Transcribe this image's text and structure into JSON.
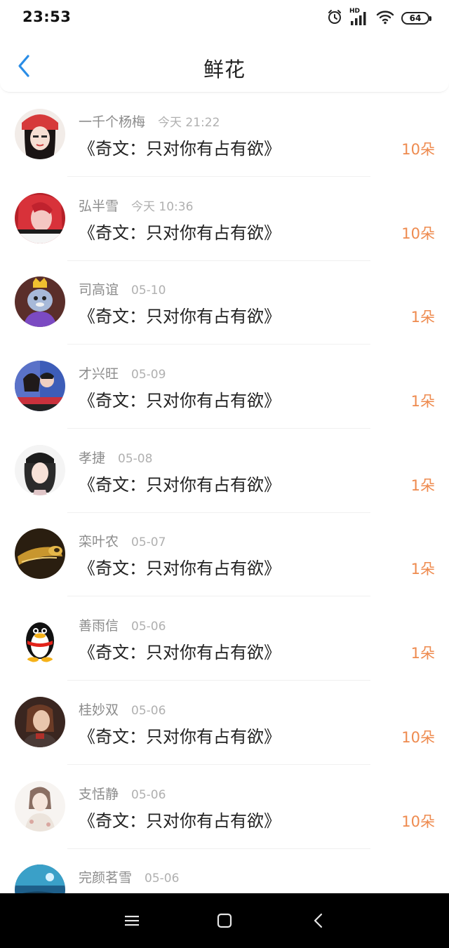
{
  "status_bar": {
    "time": "23:53",
    "network_label": "HD",
    "battery_level": "64",
    "icons": [
      "alarm-icon",
      "signal-icon",
      "wifi-icon",
      "battery-icon"
    ]
  },
  "header": {
    "title": "鲜花",
    "back_icon": "chevron-left-icon",
    "accent_color": "#2a8de6"
  },
  "list": {
    "count_color": "#ee8a4e",
    "items": [
      {
        "user": "一千个杨梅",
        "time": "今天 21:22",
        "title": "《奇文：只对你有占有欲》",
        "count": "10朵",
        "avatar": "portrait-girl-red-hat"
      },
      {
        "user": "弘半雪",
        "time": "今天 10:36",
        "title": "《奇文：只对你有占有欲》",
        "count": "10朵",
        "avatar": "portrait-red-hair"
      },
      {
        "user": "司高谊",
        "time": "05-10",
        "title": "《奇文：只对你有占有欲》",
        "count": "1朵",
        "avatar": "cartoon-rabbit-crown"
      },
      {
        "user": "才兴旺",
        "time": "05-09",
        "title": "《奇文：只对你有占有欲》",
        "count": "1朵",
        "avatar": "couple-photo"
      },
      {
        "user": "孝捷",
        "time": "05-08",
        "title": "《奇文：只对你有占有欲》",
        "count": "1朵",
        "avatar": "portrait-girl-beanie"
      },
      {
        "user": "栾叶农",
        "time": "05-07",
        "title": "《奇文：只对你有占有欲》",
        "count": "1朵",
        "avatar": "golden-object"
      },
      {
        "user": "善雨信",
        "time": "05-06",
        "title": "《奇文：只对你有占有欲》",
        "count": "1朵",
        "avatar": "qq-penguin"
      },
      {
        "user": "桂妙双",
        "time": "05-06",
        "title": "《奇文：只对你有占有欲》",
        "count": "10朵",
        "avatar": "portrait-dark"
      },
      {
        "user": "支恬静",
        "time": "05-06",
        "title": "《奇文：只对你有占有欲》",
        "count": "10朵",
        "avatar": "sketch-girl"
      },
      {
        "user": "完颜茗雪",
        "time": "05-06",
        "title": "",
        "count": "",
        "avatar": "blue-scene"
      }
    ]
  },
  "system_nav": {
    "buttons": [
      "menu-icon",
      "home-icon",
      "back-icon"
    ]
  }
}
